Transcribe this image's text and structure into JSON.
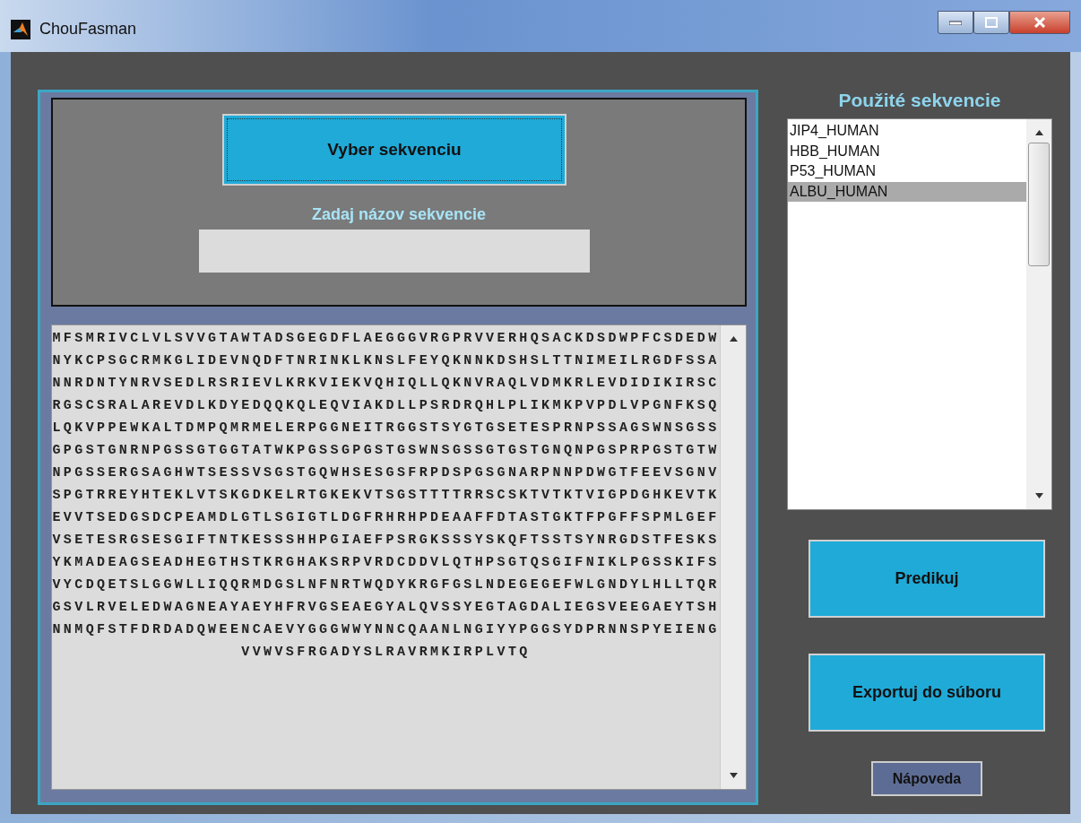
{
  "window": {
    "title": "ChouFasman"
  },
  "select_button": {
    "label": "Vyber sekvenciu"
  },
  "name_field": {
    "label": "Zadaj názov sekvencie"
  },
  "sequence_lines": [
    "MFSMRIVCLVLSVVGTAWTADSGEGDFLAEGGGVRGPRVVERHQSACKDSDWPFCSDEDW",
    "NYKCPSGCRMKGLIDEVNQDFTNRINKLKNSLFEYQKNNKDSHSLTTNIMEILRGDFSSA",
    "NNRDNTYNRVSEDLRSRIEVLKRKVIEKVQHIQLLQKNVRAQLVDMKRLEVDIDIKIRSC",
    "RGSCSRALAREVDLKDYEDQQKQLEQVIAKDLLPSRDRQHLPLIKMKPVPDLVPGNFKSQ",
    "LQKVPPEWKALTDMPQMRMELERPGGNEITRGGSTSYGTGSETESPRNPSSAGSWNSGSS",
    "GPGSTGNRNPGSSGTGGTATWKPGSSGPGSTGSWNSGSSGTGSTGNQNPGSPRPGSTGTW",
    "NPGSSERGSAGHWTSESSVSGSTGQWHSESGSFRPDSPGSGNARPNNPDWGTFEEVSGNV",
    "SPGTRREYHTEKLVTSKGDKELRTGKEKVTSGSTTTTRRSCSKTVTKTVIGPDGHKEVTK",
    "EVVTSEDGSDCPEAMDLGTLSGIGTLDGFRHRHPDEAAFFDTASTGKTFPGFFSPMLGEF",
    "VSETESRGSESGIFTNTKESSSHHPGIAEFPSRGKSSSYSKQFTSSTSYNRGDSTFESKS",
    "YKMADEAGSEADHEGTHSTKRGHAKSRPVRDCDDVLQTHPSGTQSGIFNIKLPGSSKIFS",
    "VYCDQETSLGGWLLIQQRMDGSLNFNRTWQDYKRGFGSLNDEGEGEFWLGNDYLHLLTQR",
    "GSVLRVELEDWAGNEAYAEYHFRVGSEAEGYALQVSSYEGTAGDALIEGSVEEGAEYTSH",
    "NNMQFSTFDRDADQWEENCAEVYGGGWWYNNCQAANLNGIYYPGGSYDPRNNSPYEIENG",
    "VVWVSFRGADYSLRAVRMKIRPLVTQ"
  ],
  "used_sequences": {
    "title": "Použité sekvencie",
    "items": [
      {
        "label": "JIP4_HUMAN",
        "selected": false
      },
      {
        "label": "HBB_HUMAN",
        "selected": false
      },
      {
        "label": "P53_HUMAN",
        "selected": false
      },
      {
        "label": "ALBU_HUMAN",
        "selected": true
      }
    ]
  },
  "buttons": [
    {
      "label": "Predikuj"
    },
    {
      "label": "Exportuj do súboru"
    }
  ],
  "help_button": {
    "label": "Nápoveda"
  }
}
